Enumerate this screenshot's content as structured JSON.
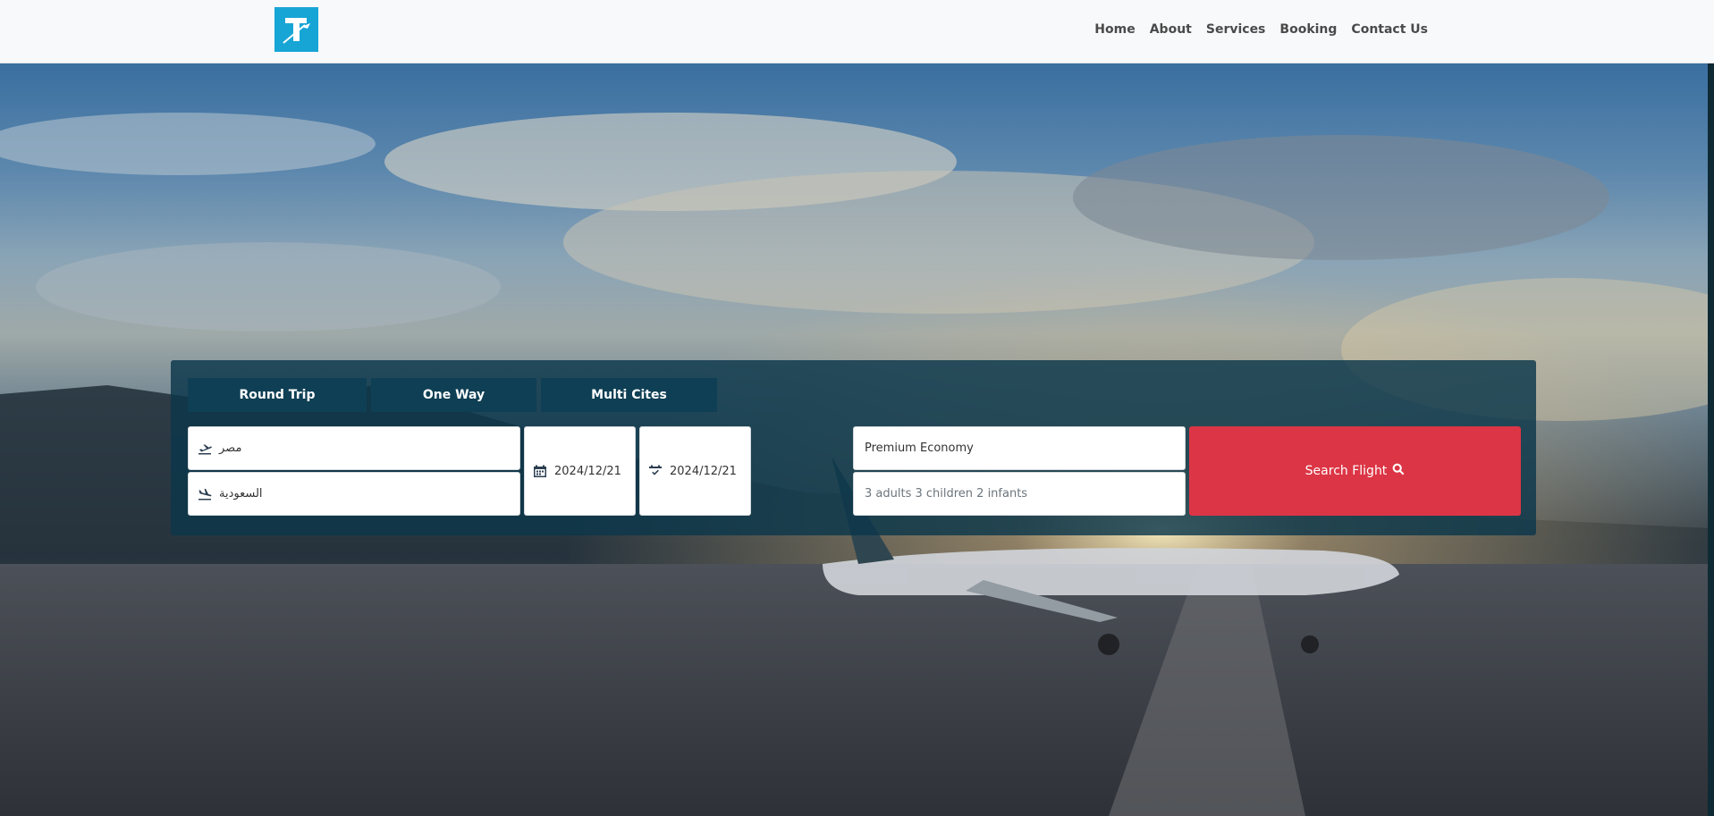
{
  "header": {
    "logo_icon": "travel-plane-logo",
    "nav": [
      {
        "label": "Home"
      },
      {
        "label": "About"
      },
      {
        "label": "Services"
      },
      {
        "label": "Booking"
      },
      {
        "label": "Contact Us"
      }
    ]
  },
  "search": {
    "tabs": [
      {
        "label": "Round Trip"
      },
      {
        "label": "One Way"
      },
      {
        "label": "Multi Cites"
      }
    ],
    "from": {
      "value": "مصر",
      "icon": "plane-departure-icon"
    },
    "to": {
      "value": "السعودية",
      "icon": "plane-arrival-icon"
    },
    "depart_date": {
      "value": "2024/12/21",
      "icon": "calendar-icon"
    },
    "return_date": {
      "value": "2024/12/21",
      "icon": "calendar-check-icon"
    },
    "cabin_class": {
      "value": "Premium Economy"
    },
    "travelers": {
      "value": "3 adults 3 children 2 infants"
    },
    "submit_label": "Search Flight",
    "submit_icon": "search-icon"
  },
  "colors": {
    "accent": "#dc3545",
    "panel": "#0b374b",
    "tab": "#0f3f54",
    "logo": "#17a5d6"
  }
}
